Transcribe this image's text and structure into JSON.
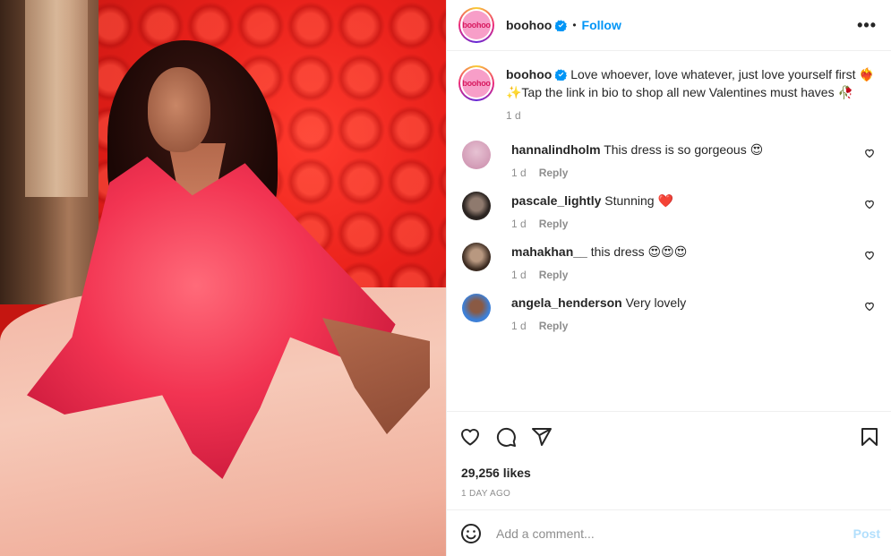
{
  "header": {
    "username": "boohoo",
    "logo_text": "boohoo",
    "separator": "•",
    "follow_label": "Follow",
    "more_label": "•••"
  },
  "caption": {
    "username": "boohoo",
    "text": " Love whoever, love whatever, just love yourself first ❤️‍🔥✨Tap the link in bio to shop all new Valentines must haves 🥀",
    "time": "1 d"
  },
  "comments": [
    {
      "username": "hannalindholm",
      "text": " This dress is so gorgeous 😍",
      "time": "1 d",
      "reply_label": "Reply",
      "avatar_color": "#d9a6c4"
    },
    {
      "username": "pascale_lightly",
      "text": " Stunning ❤️",
      "time": "1 d",
      "reply_label": "Reply",
      "avatar_color": "#2b2421"
    },
    {
      "username": "mahakhan__",
      "text": " this dress 😍😍😍",
      "time": "1 d",
      "reply_label": "Reply",
      "avatar_color": "#5a4637"
    },
    {
      "username": "angela_henderson",
      "text": " Very lovely",
      "time": "1 d",
      "reply_label": "Reply",
      "avatar_color": "#3d7fd6"
    }
  ],
  "actions": {
    "likes": "29,256 likes",
    "posted_ago": "1 DAY AGO"
  },
  "add_comment": {
    "placeholder": "Add a comment...",
    "post_label": "Post"
  },
  "colors": {
    "accent": "#0095f6",
    "post_disabled": "#b2dffc",
    "muted": "#8e8e8e"
  },
  "icons": [
    "verified-badge-icon",
    "more-options-icon",
    "heart-icon",
    "comment-icon",
    "share-icon",
    "bookmark-icon",
    "emoji-icon"
  ]
}
